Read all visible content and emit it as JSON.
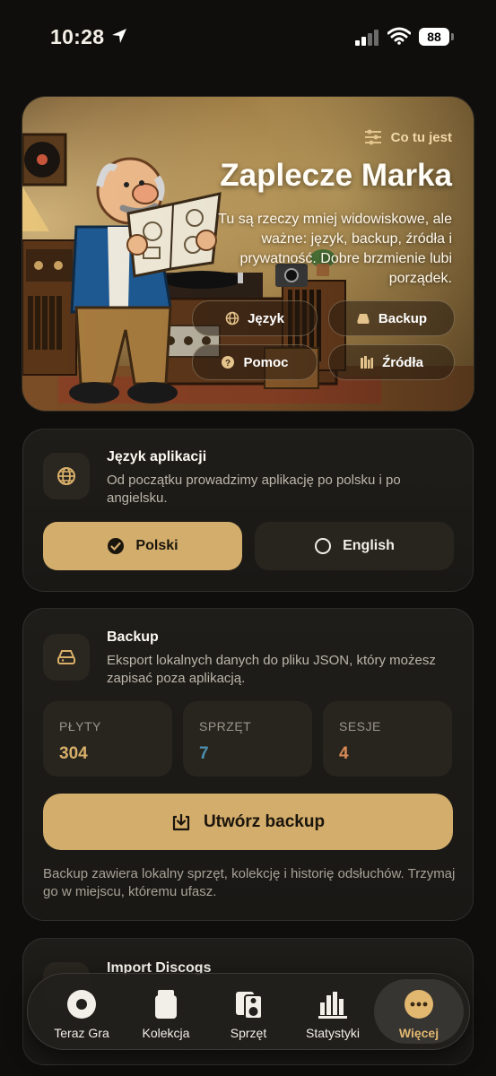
{
  "status_bar": {
    "time": "10:28",
    "battery": "88"
  },
  "hero": {
    "hint": "Co tu jest",
    "title": "Zaplecze Marka",
    "description": "Tu są rzeczy mniej widowiskowe, ale ważne: język, backup, źródła i prywatność. Dobre brzmienie lubi porządek.",
    "chips": {
      "language": "Język",
      "backup": "Backup",
      "help": "Pomoc",
      "sources": "Źródła"
    }
  },
  "language_card": {
    "title": "Język aplikacji",
    "description": "Od początku prowadzimy aplikację po polsku i po angielsku.",
    "options": {
      "polish": "Polski",
      "english": "English"
    },
    "selected": "Polski"
  },
  "backup_card": {
    "title": "Backup",
    "description": "Eksport lokalnych danych do pliku JSON, który możesz zapisać poza aplikacją.",
    "stats": [
      {
        "label": "PŁYTY",
        "value": "304",
        "color": "#d8b06a"
      },
      {
        "label": "SPRZĘT",
        "value": "7",
        "color": "#4c8fb0"
      },
      {
        "label": "SESJE",
        "value": "4",
        "color": "#d98a55"
      }
    ],
    "button": "Utwórz backup",
    "note": "Backup zawiera lokalny sprzęt, kolekcję i historię odsłuchów. Trzymaj go w miejscu, któremu ufasz."
  },
  "import_card": {
    "title": "Import Discogs"
  },
  "tabbar": {
    "tabs": [
      {
        "label": "Teraz Gra",
        "icon": "record-icon"
      },
      {
        "label": "Kolekcja",
        "icon": "crate-icon"
      },
      {
        "label": "Sprzęt",
        "icon": "speaker-icon"
      },
      {
        "label": "Statystyki",
        "icon": "bars-icon"
      },
      {
        "label": "Więcej",
        "icon": "more-icon"
      }
    ],
    "active": "Więcej"
  },
  "colors": {
    "accent": "#d3ad6b",
    "background": "#0f0e0c",
    "card": "#1c1a17"
  }
}
